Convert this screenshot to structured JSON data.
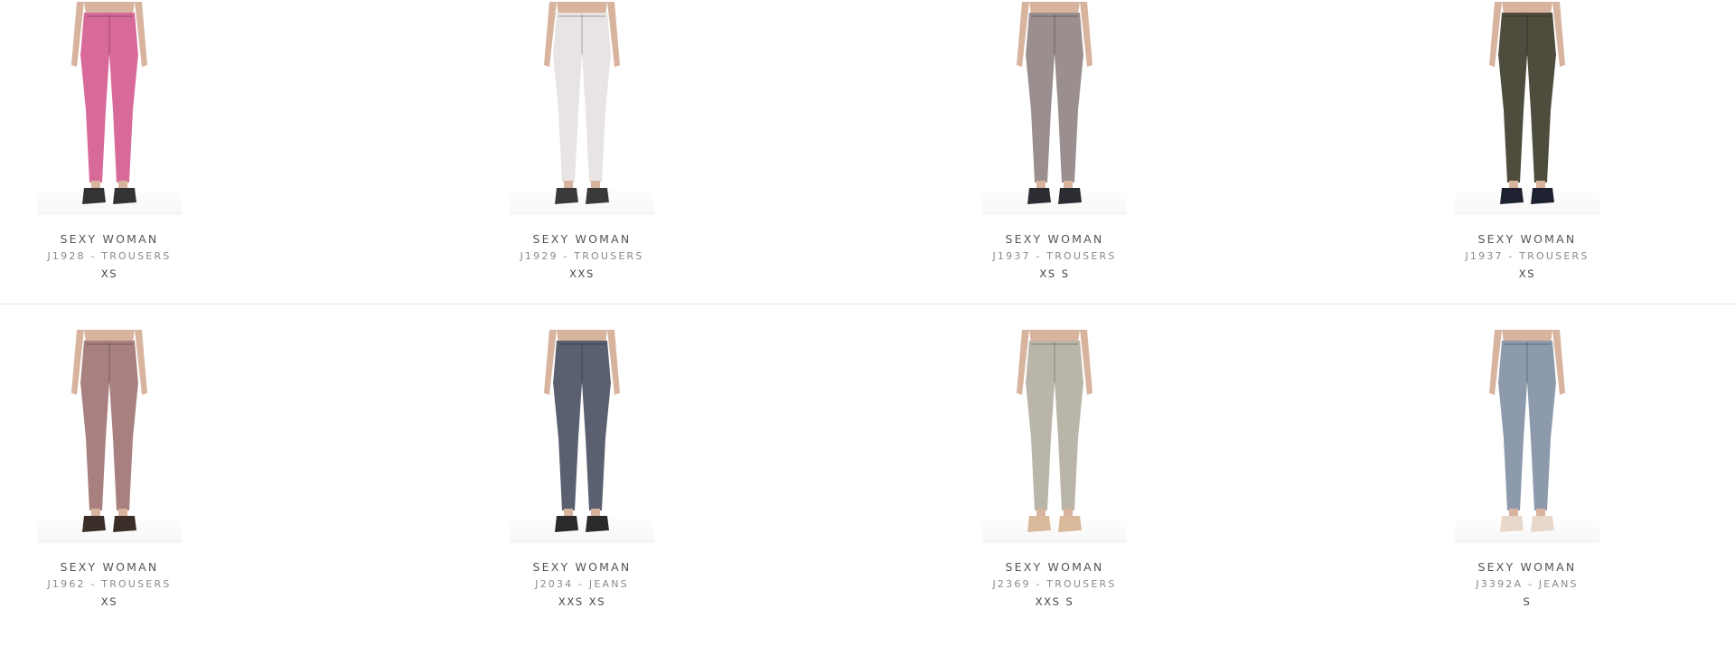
{
  "products": [
    {
      "brand": "SEXY WOMAN",
      "sku": "J1928 - TROUSERS",
      "sizes": [
        "XS"
      ],
      "image": "pink-floral-trousers-photo",
      "color": "#d86a9a",
      "shoe": "#333333"
    },
    {
      "brand": "SEXY WOMAN",
      "sku": "J1929 - TROUSERS",
      "sizes": [
        "XXS"
      ],
      "image": "white-trousers-photo",
      "color": "#e7e4e3",
      "shoe": "#3a3a3a"
    },
    {
      "brand": "SEXY WOMAN",
      "sku": "J1937 - TROUSERS",
      "sizes": [
        "XS",
        "S"
      ],
      "image": "grey-trousers-photo",
      "color": "#9a8e8e",
      "shoe": "#2c2c33"
    },
    {
      "brand": "SEXY WOMAN",
      "sku": "J1937 - TROUSERS",
      "sizes": [
        "XS"
      ],
      "image": "olive-trousers-photo",
      "color": "#4e4c3c",
      "shoe": "#1e2230"
    },
    {
      "brand": "SEXY WOMAN",
      "sku": "J1962 - TROUSERS",
      "sizes": [
        "XS"
      ],
      "image": "mauve-trousers-photo",
      "color": "#a88080",
      "shoe": "#3b2e28"
    },
    {
      "brand": "SEXY WOMAN",
      "sku": "J2034 - JEANS",
      "sizes": [
        "XXS",
        "XS"
      ],
      "image": "acid-wash-jeans-photo",
      "color": "#5a6070",
      "shoe": "#2a2a2a"
    },
    {
      "brand": "SEXY WOMAN",
      "sku": "J2369 - TROUSERS",
      "sizes": [
        "XXS",
        "S"
      ],
      "image": "beige-trousers-photo",
      "color": "#b9b5a8",
      "shoe": "#d9b99a"
    },
    {
      "brand": "SEXY WOMAN",
      "sku": "J3392A - JEANS",
      "sizes": [
        "S"
      ],
      "image": "light-wash-jeans-photo",
      "color": "#8c9aac",
      "shoe": "#e8d8cc"
    }
  ]
}
